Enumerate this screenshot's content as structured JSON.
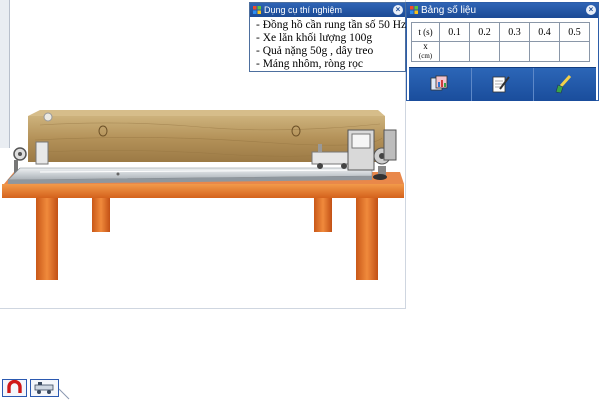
{
  "equipment_panel": {
    "title": "Dụng cụ thí nghiệm",
    "items": [
      "- Đồng hồ cần rung tần số 50 Hz",
      "- Xe lăn khối lượng 100g",
      "- Quả nặng 50g , dây treo",
      "- Máng nhôm, ròng rọc"
    ]
  },
  "data_panel": {
    "title": "Bảng số liệu",
    "row_t_label": "t (s)",
    "t_values": [
      "0.1",
      "0.2",
      "0.3",
      "0.4",
      "0.5"
    ],
    "row_x_label": "x",
    "row_x_unit": "(cm)",
    "x_values": [
      "",
      "",
      "",
      "",
      ""
    ],
    "tools": [
      "chart-icon",
      "edit-pen-icon",
      "eraser-brush-icon"
    ]
  },
  "bottom_buttons": [
    "magnet-icon",
    "cart-icon"
  ],
  "colors": {
    "title_bar": "#1f52a0",
    "table_wood": "#e0782a",
    "box_wood": "#b9955a",
    "rail": "#c9cfd4"
  }
}
